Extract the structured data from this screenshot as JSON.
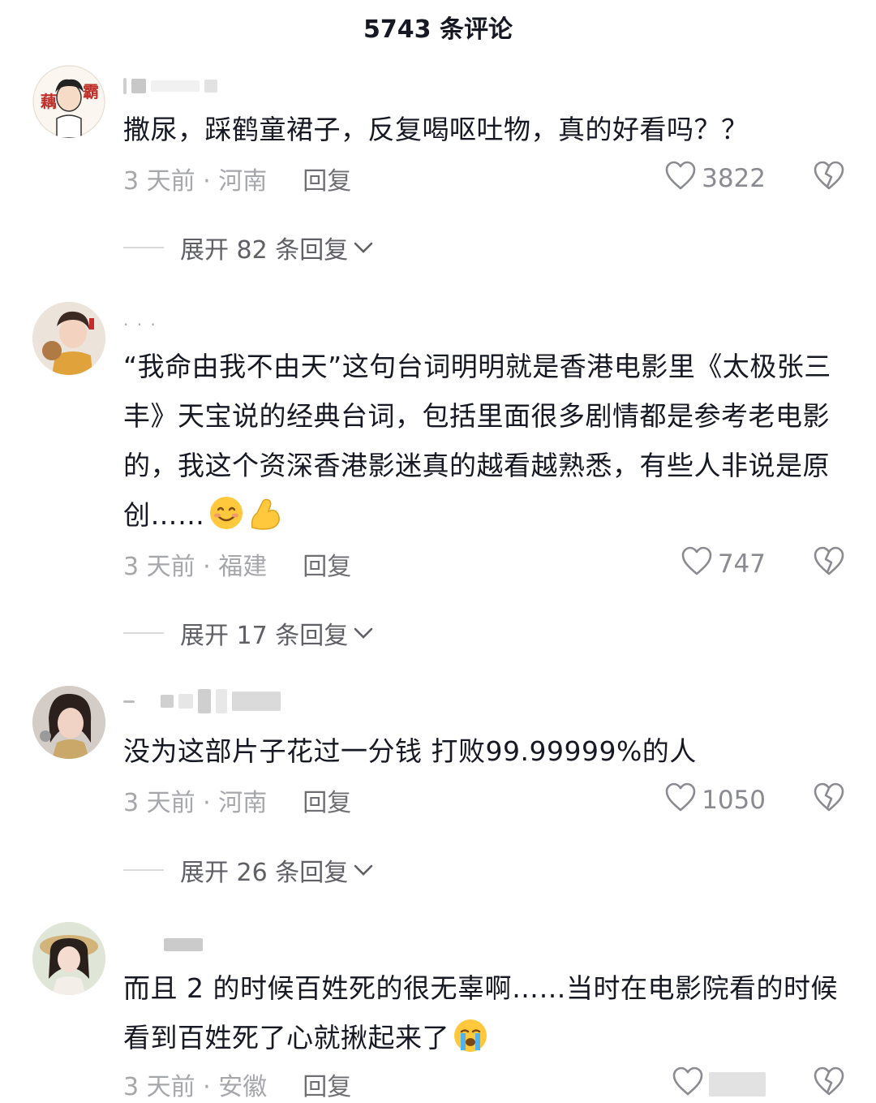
{
  "header": {
    "title": "5743 条评论"
  },
  "comments": [
    {
      "text": "撒尿，踩鹤童裙子，反复喝呕吐物，真的好看吗？？",
      "time_location": "3 天前 · 河南",
      "reply_label": "回复",
      "likes": "3822",
      "expand_label": "展开 82 条回复"
    },
    {
      "text": "“我命由我不由天”这句台词明明就是香港电影里《太极张三丰》天宝说的经典台词，包括里面很多剧情都是参考老电影的，我这个资深香港影迷真的越看越熟悉，有些人非说是原创……",
      "time_location": "3 天前 · 福建",
      "reply_label": "回复",
      "likes": "747",
      "expand_label": "展开 17 条回复",
      "emojis": [
        "smile-emoji",
        "flex-arm-emoji"
      ]
    },
    {
      "text": "没为这部片子花过一分钱 打败99.99999%的人",
      "time_location": "3 天前 · 河南",
      "reply_label": "回复",
      "likes": "1050",
      "expand_label": "展开 26 条回复"
    },
    {
      "text": "而且 2 的时候百姓死的很无辜啊……当时在电影院看的时候看到百姓死了心就揪起来了",
      "time_location": "3 天前 · 安徽",
      "reply_label": "回复",
      "likes": "",
      "emojis": [
        "crying-emoji"
      ]
    }
  ],
  "colors": {
    "text": "#161823",
    "meta": "#a6a7ab",
    "reply": "#6e6e73"
  },
  "avatar_lettering": {
    "left": "藕",
    "right": "霸"
  }
}
